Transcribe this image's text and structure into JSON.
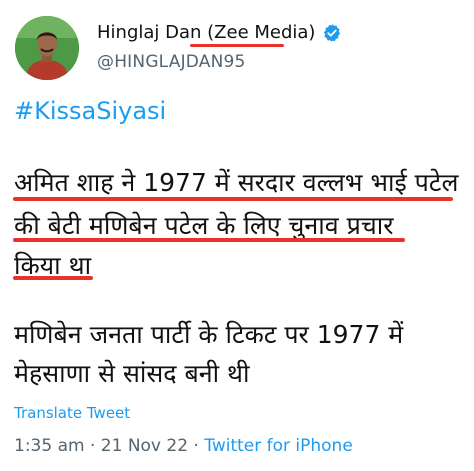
{
  "author": {
    "display_name": "Hinglaj Dan (Zee Media)",
    "handle": "@HINGLAJDAN95",
    "verified": true,
    "accent_color": "#1d9bf0"
  },
  "tweet": {
    "hashtag": "#KissaSiyasi",
    "para1_lines": [
      "अमित शाह ने 1977 में सरदार वल्लभ भाई पटेल",
      "की बेटी मणिबेन पटेल के लिए चुनाव प्रचार",
      "किया था"
    ],
    "para2_lines": [
      "मणिबेन जनता पार्टी के टिकट पर 1977 में",
      "मेहसाणा से सांसद बनी थी"
    ],
    "translate_label": "Translate Tweet",
    "time": "1:35 am",
    "date": "21 Nov 22",
    "source": "Twitter for iPhone",
    "separator": "·"
  },
  "annotation_color": "#e8332b"
}
